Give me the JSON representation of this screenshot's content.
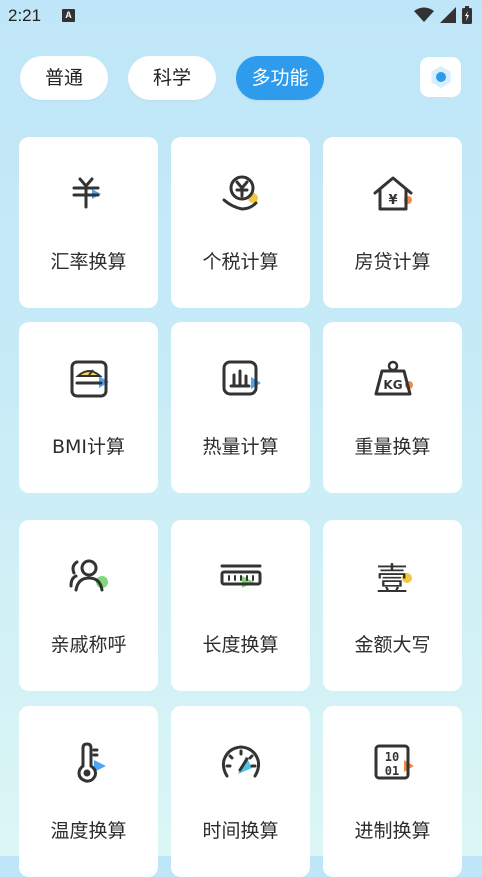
{
  "status_bar": {
    "time": "2:21",
    "notification_glyph": "A"
  },
  "modes": [
    {
      "label": "普通",
      "active": false
    },
    {
      "label": "科学",
      "active": false
    },
    {
      "label": "多功能",
      "active": true
    }
  ],
  "accent_color": "#2e9bec",
  "tools": [
    {
      "label": "汇率换算",
      "icon": "currency-exchange-icon"
    },
    {
      "label": "个税计算",
      "icon": "income-tax-icon"
    },
    {
      "label": "房贷计算",
      "icon": "mortgage-icon"
    },
    {
      "label": "BMI计算",
      "icon": "bmi-scale-icon"
    },
    {
      "label": "热量计算",
      "icon": "calorie-chart-icon"
    },
    {
      "label": "重量换算",
      "icon": "weight-kg-icon"
    },
    {
      "label": "亲戚称呼",
      "icon": "relatives-icon"
    },
    {
      "label": "长度换算",
      "icon": "ruler-icon"
    },
    {
      "label": "金额大写",
      "icon": "amount-uppercase-icon"
    },
    {
      "label": "温度换算",
      "icon": "thermometer-icon"
    },
    {
      "label": "时间换算",
      "icon": "speedometer-icon"
    },
    {
      "label": "进制换算",
      "icon": "binary-icon"
    }
  ]
}
